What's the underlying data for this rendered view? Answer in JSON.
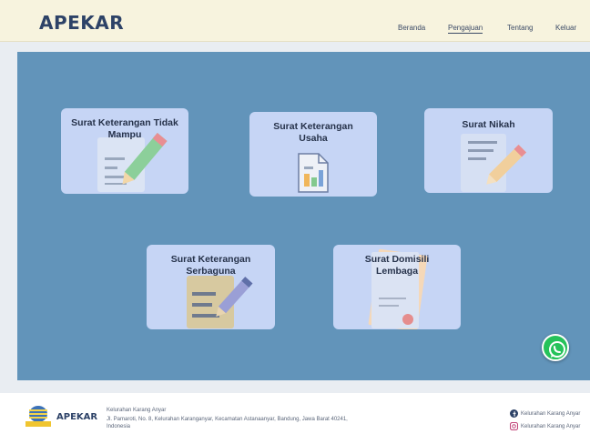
{
  "header": {
    "brand": "APEKAR",
    "nav": [
      "Beranda",
      "Pengajuan",
      "Tentang",
      "Keluar"
    ]
  },
  "cards": [
    {
      "title_line1": "Surat Keterangan Tidak",
      "title_line2": "Mampu",
      "icon": "document-pencil-icon"
    },
    {
      "title_line1": "Surat Keterangan",
      "title_line2": "Usaha",
      "icon": "business-document-icon"
    },
    {
      "title_line1": "Surat Nikah",
      "title_line2": "",
      "icon": "marriage-document-icon"
    },
    {
      "title_line1": "Surat Keterangan",
      "title_line2": "Serbaguna",
      "icon": "clipboard-pencil-icon"
    },
    {
      "title_line1": "Surat Domisili",
      "title_line2": "Lembaga",
      "icon": "certificate-icon"
    }
  ],
  "footer": {
    "brand": "APEKAR",
    "org": "Kelurahan Karang Anyar",
    "address": "Jl. Pamaroti, No. 8, Kelurahan Karanganyar, Kecamatan Astanaanyar, Bandung, Jawa Barat 40241, Indonesia",
    "facebook": "Kelurahan Karang Anyar",
    "instagram": "Kelurahan Karang Anyar"
  },
  "colors": {
    "header_bg": "#f7f3de",
    "main_bg": "#6294ba",
    "card_bg": "#c6d5f5",
    "brand": "#2d4267",
    "whatsapp": "#25c25a"
  }
}
